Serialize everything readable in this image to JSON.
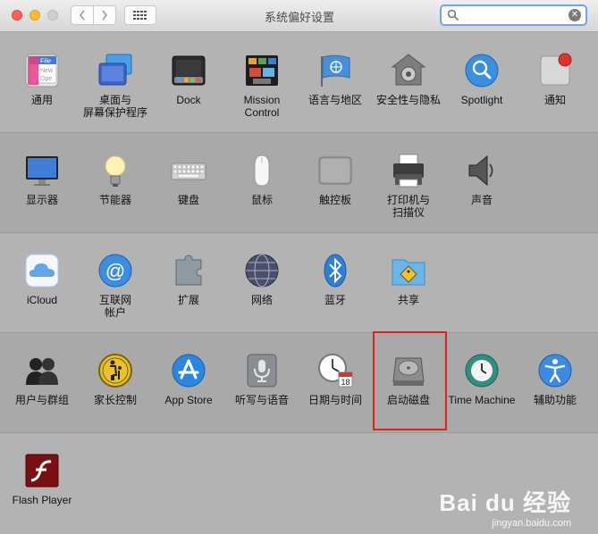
{
  "window": {
    "title": "系统偏好设置"
  },
  "search": {
    "value": ""
  },
  "sections": [
    {
      "items": [
        {
          "label": "通用",
          "icon": "general-icon"
        },
        {
          "label": "桌面与\n屏幕保护程序",
          "icon": "desktop-icon"
        },
        {
          "label": "Dock",
          "icon": "dock-icon"
        },
        {
          "label": "Mission\nControl",
          "icon": "mission-control-icon"
        },
        {
          "label": "语言与地区",
          "icon": "language-icon"
        },
        {
          "label": "安全性与隐私",
          "icon": "security-icon"
        },
        {
          "label": "Spotlight",
          "icon": "spotlight-icon"
        },
        {
          "label": "通知",
          "icon": "notifications-icon"
        }
      ]
    },
    {
      "items": [
        {
          "label": "显示器",
          "icon": "display-icon"
        },
        {
          "label": "节能器",
          "icon": "energy-icon"
        },
        {
          "label": "键盘",
          "icon": "keyboard-icon"
        },
        {
          "label": "鼠标",
          "icon": "mouse-icon"
        },
        {
          "label": "触控板",
          "icon": "trackpad-icon"
        },
        {
          "label": "打印机与\n扫描仪",
          "icon": "printer-icon"
        },
        {
          "label": "声音",
          "icon": "sound-icon"
        }
      ]
    },
    {
      "items": [
        {
          "label": "iCloud",
          "icon": "icloud-icon"
        },
        {
          "label": "互联网\n帐户",
          "icon": "internet-accounts-icon"
        },
        {
          "label": "扩展",
          "icon": "extensions-icon"
        },
        {
          "label": "网络",
          "icon": "network-icon"
        },
        {
          "label": "蓝牙",
          "icon": "bluetooth-icon"
        },
        {
          "label": "共享",
          "icon": "sharing-icon"
        }
      ]
    },
    {
      "items": [
        {
          "label": "用户与群组",
          "icon": "users-icon"
        },
        {
          "label": "家长控制",
          "icon": "parental-icon"
        },
        {
          "label": "App Store",
          "icon": "appstore-icon"
        },
        {
          "label": "听写与语音",
          "icon": "dictation-icon"
        },
        {
          "label": "日期与时间",
          "icon": "datetime-icon"
        },
        {
          "label": "启动磁盘",
          "icon": "startup-disk-icon"
        },
        {
          "label": "Time Machine",
          "icon": "timemachine-icon"
        },
        {
          "label": "辅助功能",
          "icon": "accessibility-icon"
        }
      ]
    },
    {
      "items": [
        {
          "label": "Flash Player",
          "icon": "flash-icon"
        }
      ]
    }
  ],
  "general_icon_text": [
    "File",
    "New",
    "Ope"
  ],
  "calendar_day": "18",
  "watermark": {
    "brand": "Bai du 经验",
    "url": "jingyan.baidu.com"
  }
}
